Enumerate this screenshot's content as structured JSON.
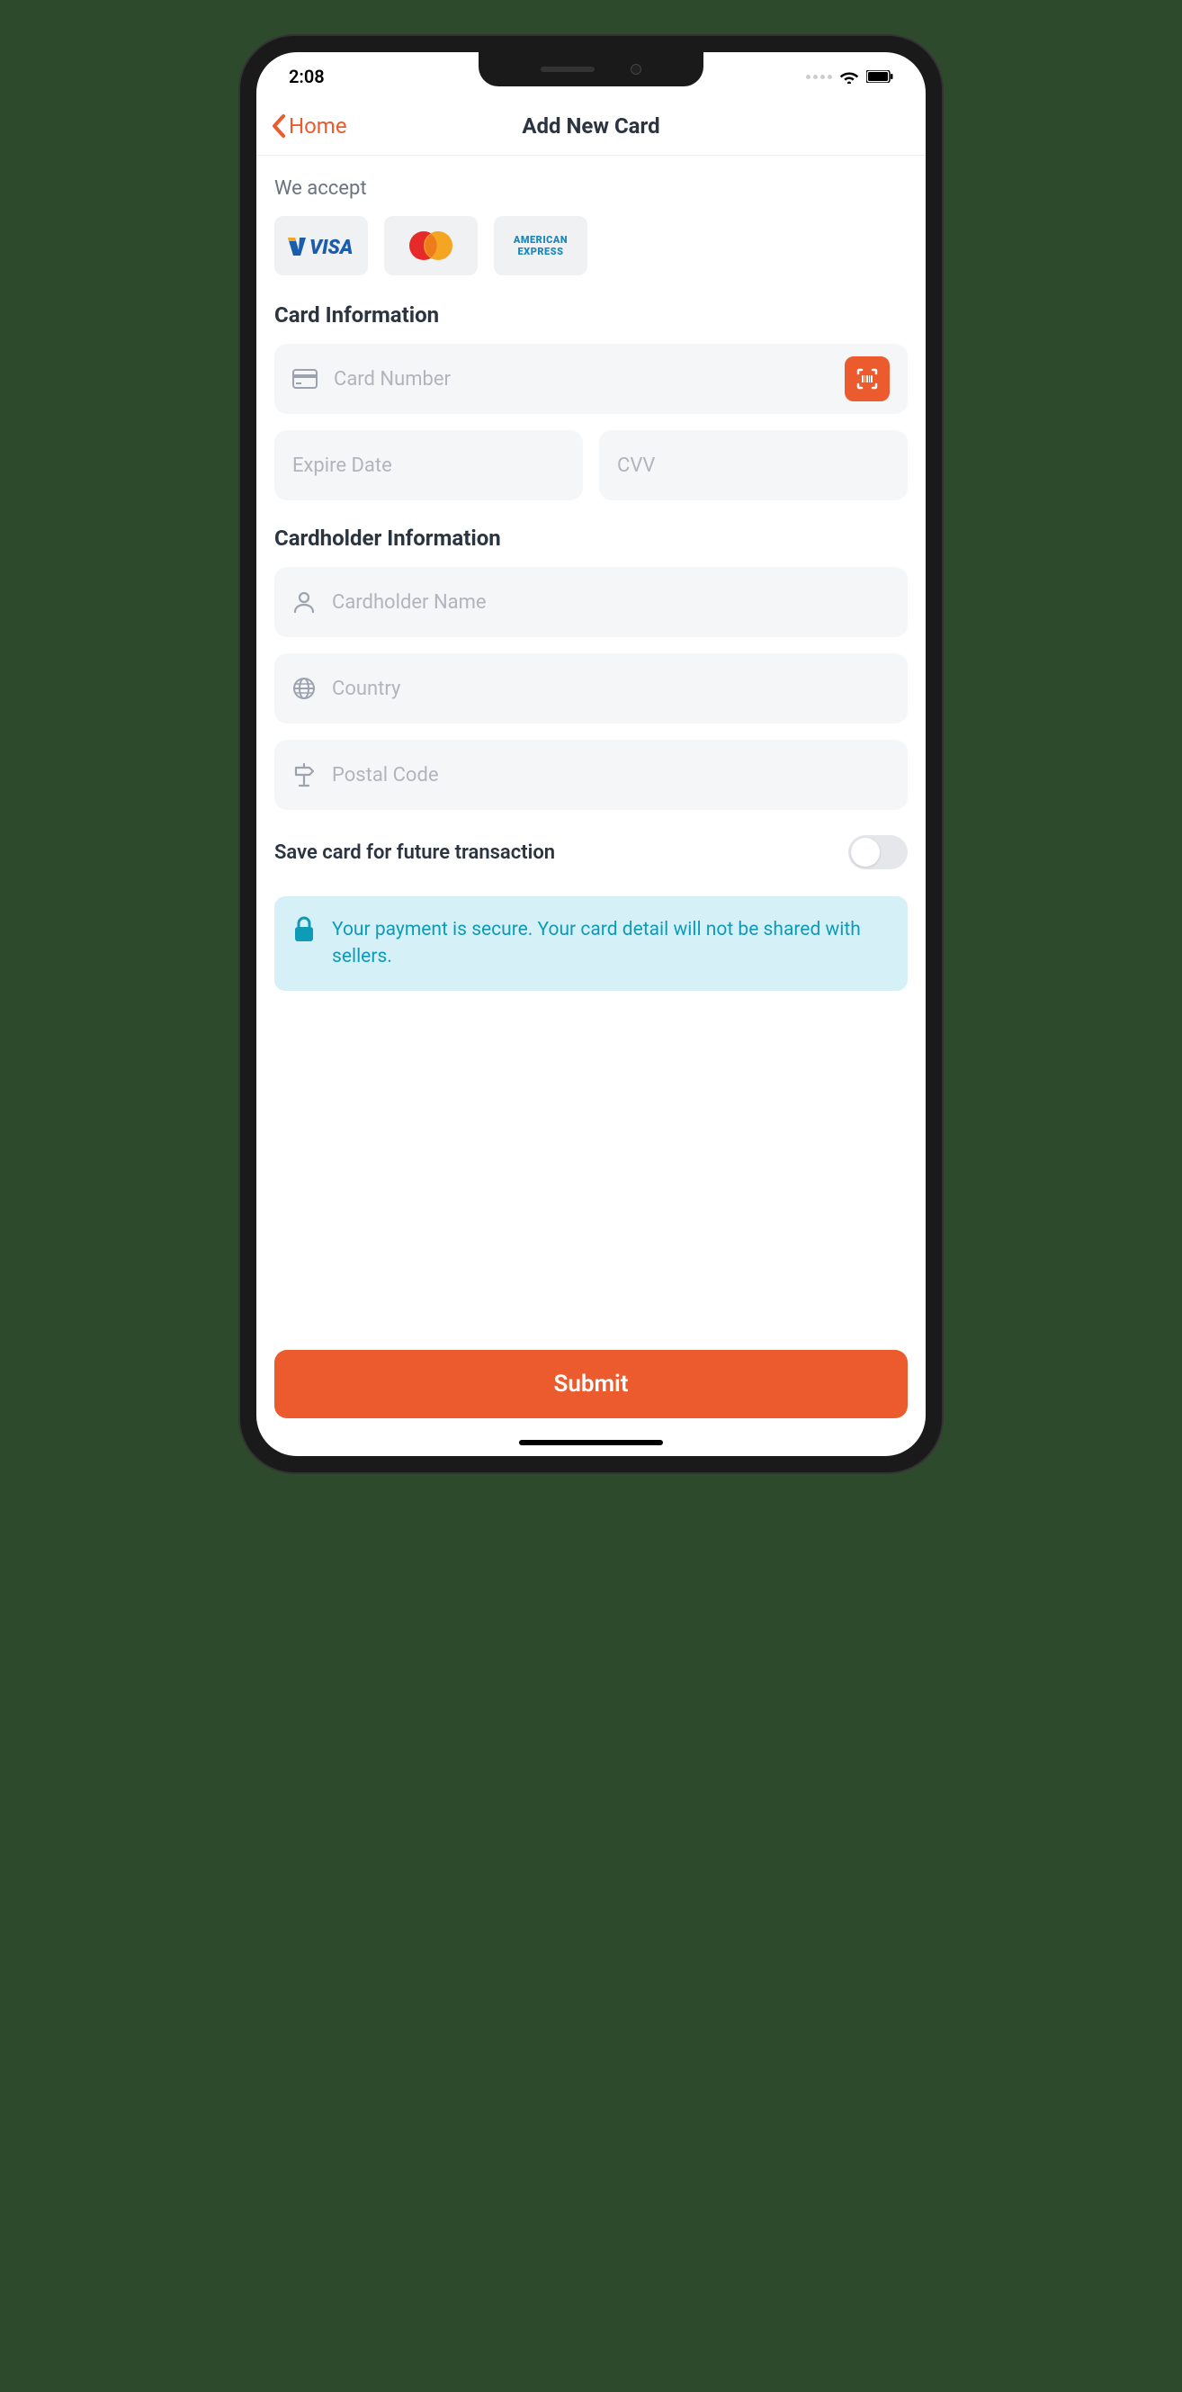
{
  "status": {
    "time": "2:08"
  },
  "nav": {
    "back_label": "Home",
    "title": "Add New Card"
  },
  "accept": {
    "label": "We accept"
  },
  "sections": {
    "card_info": "Card Information",
    "holder_info": "Cardholder Information"
  },
  "fields": {
    "card_number": "Card Number",
    "expire": "Expire Date",
    "cvv": "CVV",
    "name": "Cardholder Name",
    "country": "Country",
    "postal": "Postal Code"
  },
  "toggle": {
    "label": "Save card for future transaction"
  },
  "notice": {
    "text": "Your payment is secure. Your card detail will not be shared with sellers."
  },
  "submit": {
    "label": "Submit"
  }
}
